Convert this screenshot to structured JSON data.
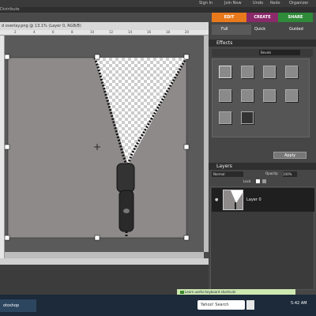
{
  "menubar": {
    "signin": "Sign In",
    "joinnow": "Join Now",
    "undo": "Undo",
    "redo": "Redo",
    "organizer": "Organizer"
  },
  "row2": {
    "label": "Distribute"
  },
  "mode_tabs": {
    "edit": "EDIT",
    "create": "CREATE",
    "share": "SHARE"
  },
  "document": {
    "title": "d overlay.png @ 13.1% (Layer 0, RGB/8)",
    "ruler_marks": [
      "2",
      "4",
      "6",
      "8",
      "10",
      "12",
      "14",
      "16",
      "18",
      "20"
    ]
  },
  "panel": {
    "subtabs": {
      "full": "Full",
      "quick": "Quick",
      "guided": "Guided"
    },
    "effects_header": "Effects",
    "effects_dropdown": "Bevels",
    "apply": "Apply",
    "layers_header": "Layers",
    "blend_mode": "Normal",
    "opacity_label": "Opacity:",
    "opacity_value": "100%",
    "lock_label": "Lock:",
    "layer_name": "Layer 0"
  },
  "shortcut_bar": {
    "text": "Learn useful keyboard shortcuts"
  },
  "taskbar": {
    "app": "otoshop",
    "search": "Yahoo! Search",
    "clock": "5:42 AM"
  },
  "colors": {
    "edit_tab": "#e87a1c",
    "create_tab": "#8a2a6a",
    "share_tab": "#2f8a3a",
    "canvas": "#8e8a8a",
    "taskbar": "#1c2a3a"
  }
}
